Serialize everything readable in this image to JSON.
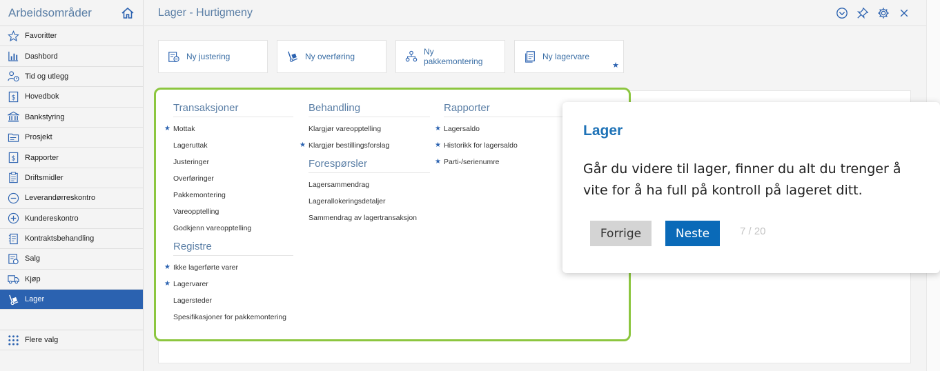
{
  "sidebar": {
    "title": "Arbeidsområder",
    "items": [
      {
        "label": "Favoritter",
        "icon": "star-icon"
      },
      {
        "label": "Dashbord",
        "icon": "bar-chart-icon"
      },
      {
        "label": "Tid og utlegg",
        "icon": "person-clock-icon"
      },
      {
        "label": "Hovedbok",
        "icon": "dollar-book-icon"
      },
      {
        "label": "Bankstyring",
        "icon": "bank-icon"
      },
      {
        "label": "Prosjekt",
        "icon": "folder-icon"
      },
      {
        "label": "Rapporter",
        "icon": "dollar-report-icon"
      },
      {
        "label": "Driftsmidler",
        "icon": "clipboard-icon"
      },
      {
        "label": "Leverandørreskontro",
        "icon": "minus-circle-icon"
      },
      {
        "label": "Kundereskontro",
        "icon": "plus-circle-icon"
      },
      {
        "label": "Kontraktsbehandling",
        "icon": "contract-icon"
      },
      {
        "label": "Salg",
        "icon": "sales-icon"
      },
      {
        "label": "Kjøp",
        "icon": "truck-icon"
      },
      {
        "label": "Lager",
        "icon": "hand-truck-icon",
        "active": true
      }
    ],
    "more": {
      "label": "Flere valg",
      "icon": "grid-dots-icon"
    }
  },
  "header": {
    "title": "Lager - Hurtigmeny",
    "tools": [
      "chevron-circle-down-icon",
      "pin-icon",
      "gear-icon",
      "close-icon"
    ]
  },
  "quick_actions": [
    {
      "label": "Ny justering",
      "icon": "adjust-icon"
    },
    {
      "label": "Ny overføring",
      "icon": "hand-truck-icon"
    },
    {
      "label": "Ny pakkemontering",
      "icon": "hierarchy-icon"
    },
    {
      "label": "Ny lagervare",
      "icon": "document-icon",
      "favorite": true
    }
  ],
  "panel": {
    "columns": [
      {
        "sections": [
          {
            "title": "Transaksjoner",
            "links": [
              {
                "label": "Mottak",
                "star": true
              },
              {
                "label": "Lageruttak"
              },
              {
                "label": "Justeringer"
              },
              {
                "label": "Overføringer"
              },
              {
                "label": "Pakkemontering"
              },
              {
                "label": "Vareopptelling"
              },
              {
                "label": "Godkjenn vareopptelling"
              }
            ]
          },
          {
            "title": "Registre",
            "links": [
              {
                "label": "Ikke lagerførte varer",
                "star": true
              },
              {
                "label": "Lagervarer",
                "star": true
              },
              {
                "label": "Lagersteder"
              },
              {
                "label": "Spesifikasjoner for pakkemontering"
              }
            ]
          }
        ]
      },
      {
        "sections": [
          {
            "title": "Behandling",
            "links": [
              {
                "label": "Klargjør vareopptelling"
              },
              {
                "label": "Klargjør bestillingsforslag",
                "star": true
              }
            ]
          },
          {
            "title": "Forespørsler",
            "links": [
              {
                "label": "Lagersammendrag"
              },
              {
                "label": "Lagerallokeringsdetaljer"
              },
              {
                "label": "Sammendrag av lagertransaksjon"
              }
            ]
          }
        ]
      },
      {
        "sections": [
          {
            "title": "Rapporter",
            "links": [
              {
                "label": "Lagersaldo",
                "star": true
              },
              {
                "label": "Historikk for lagersaldo",
                "star": true
              },
              {
                "label": "Parti-/serienumre",
                "star": true
              }
            ]
          }
        ]
      }
    ]
  },
  "tooltip": {
    "title": "Lager",
    "body": "Går du videre til lager, finner du alt du trenger å vite for å ha full på kontroll på lageret ditt.",
    "prev_label": "Forrige",
    "next_label": "Neste",
    "counter": "7 / 20"
  },
  "colors": {
    "accent": "#2b62b0",
    "highlight": "#8cc63f",
    "title": "#5b7fa6",
    "next_button": "#0a6ab8"
  }
}
